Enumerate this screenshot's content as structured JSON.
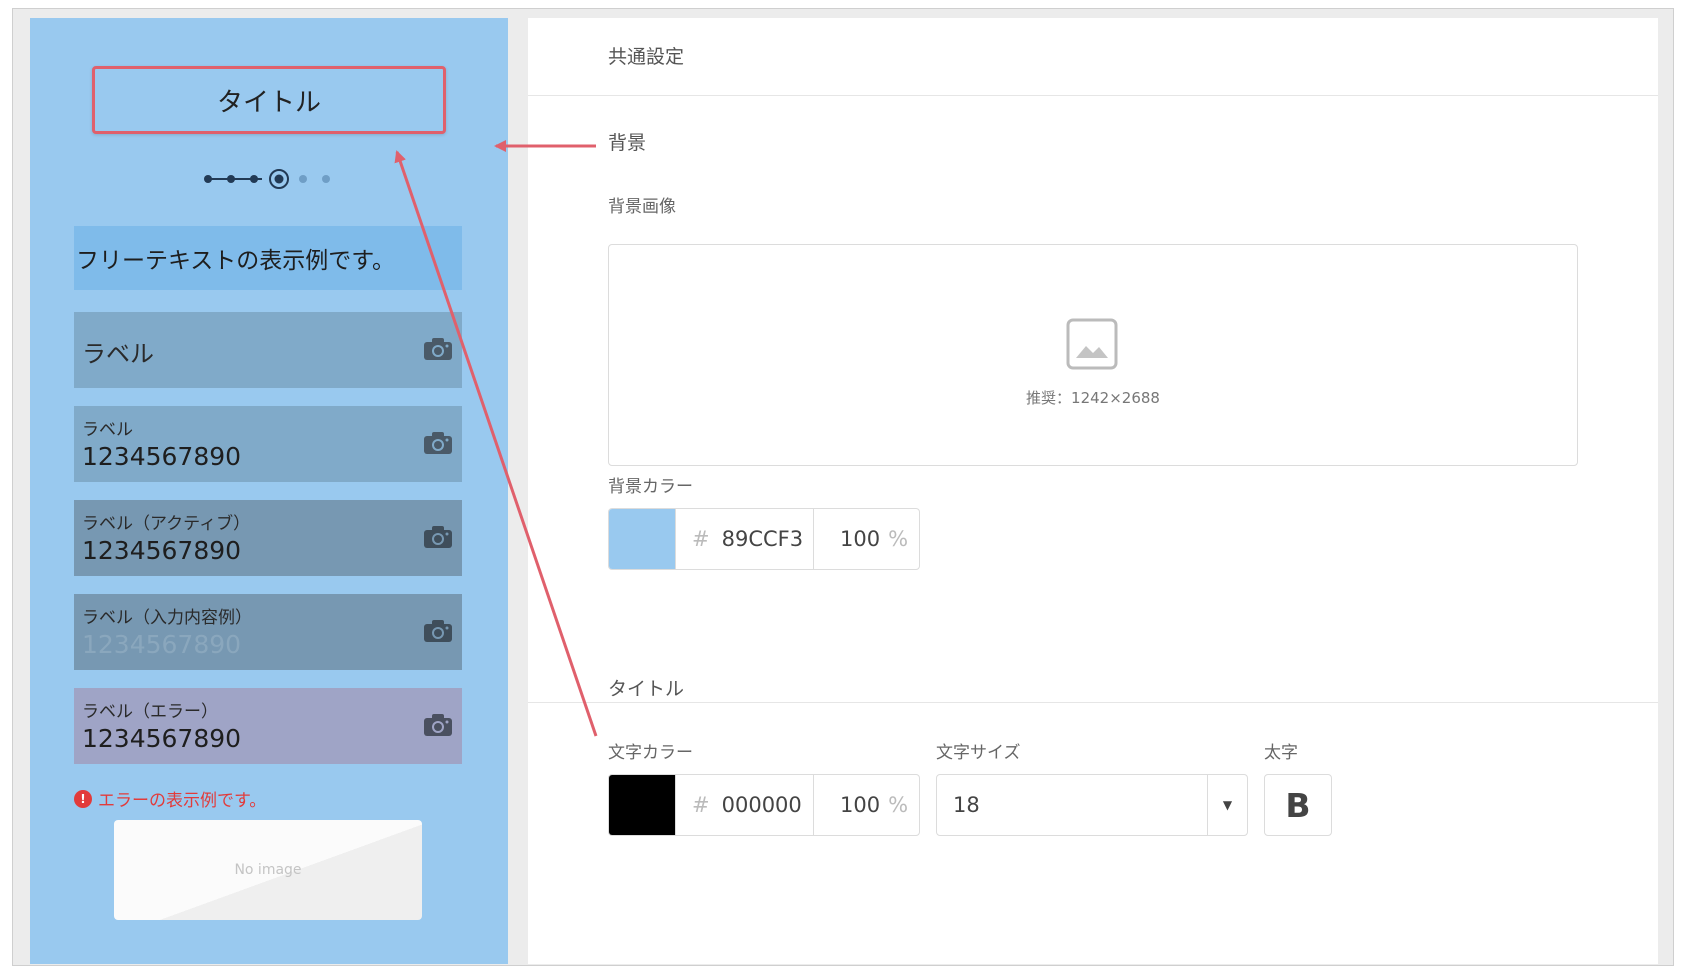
{
  "preview": {
    "title": "タイトル",
    "free_text": "フリーテキストの表示例です。",
    "fields": [
      {
        "label": "ラベル",
        "value": "",
        "style": "normal"
      },
      {
        "label": "ラベル",
        "value": "1234567890",
        "style": "normal"
      },
      {
        "label": "ラベル（アクティブ）",
        "value": "1234567890",
        "style": "active"
      },
      {
        "label": "ラベル（入力内容例）",
        "value": "1234567890",
        "style": "placeholder"
      },
      {
        "label": "ラベル（エラー）",
        "value": "1234567890",
        "style": "error"
      }
    ],
    "error_message": "エラーの表示例です。",
    "error_icon": "!",
    "no_image": "No image",
    "colors": {
      "background": "#99c9ef",
      "field": "#80aac9",
      "field_active": "#7798b2",
      "field_error": "#9fa4c6",
      "highlight": "#e0606c"
    }
  },
  "settings": {
    "header": "共通設定",
    "background_section": "背景",
    "background_image_label": "背景画像",
    "recommended": "推奨：1242×2688",
    "background_color_label": "背景カラー",
    "background_color": {
      "hash": "#",
      "hex": "89CCF3",
      "swatch": "#99c9ef",
      "alpha": "100",
      "pct": "%"
    },
    "title_section": "タイトル",
    "text_color_label": "文字カラー",
    "text_color": {
      "hash": "#",
      "hex": "000000",
      "swatch": "#000000",
      "alpha": "100",
      "pct": "%"
    },
    "font_size_label": "文字サイズ",
    "font_size_value": "18",
    "caret": "▼",
    "bold_label": "太字",
    "bold_button": "B"
  }
}
